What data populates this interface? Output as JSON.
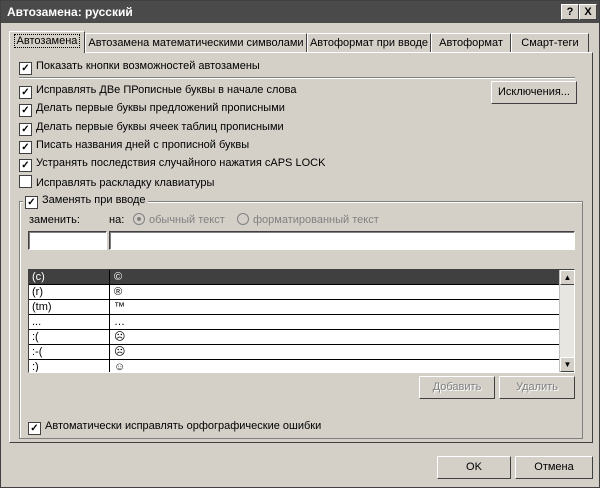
{
  "window": {
    "title": "Автозамена: русский",
    "help_btn": "?",
    "close_btn": "X"
  },
  "tabs": [
    {
      "label": "Автозамена"
    },
    {
      "label": "Автозамена математическими символами"
    },
    {
      "label": "Автоформат при вводе"
    },
    {
      "label": "Автоформат"
    },
    {
      "label": "Смарт-теги"
    }
  ],
  "options": {
    "show_buttons": "Показать кнопки возможностей автозамены",
    "two_caps": "Исправлять ДВе ПРописные буквы в начале слова",
    "sentence_caps": "Делать первые буквы предложений прописными",
    "cell_caps": "Делать первые буквы ячеек таблиц прописными",
    "day_names": "Писать названия дней с прописной буквы",
    "caps_lock": "Устранять последствия случайного нажатия cAPS LOCK",
    "keyboard_layout": "Исправлять раскладку клавиатуры",
    "replace_typing": "Заменять при вводе",
    "spell_check": "Автоматически исправлять орфографические ошибки"
  },
  "buttons": {
    "exceptions": "Исключения...",
    "add": "Добавить",
    "delete": "Удалить",
    "ok": "OK",
    "cancel": "Отмена"
  },
  "replace": {
    "replace_label": "заменить:",
    "with_label": "на:",
    "plain_text": "обычный текст",
    "formatted_text": "форматированный текст",
    "replace_value": "",
    "with_value": ""
  },
  "entries": [
    {
      "from": "(c)",
      "to": "©"
    },
    {
      "from": "(r)",
      "to": "®"
    },
    {
      "from": "(tm)",
      "to": "™"
    },
    {
      "from": "...",
      "to": "…"
    },
    {
      "from": ":(",
      "to": "☹"
    },
    {
      "from": ":-(",
      "to": "☹"
    },
    {
      "from": ":)",
      "to": "☺"
    }
  ]
}
